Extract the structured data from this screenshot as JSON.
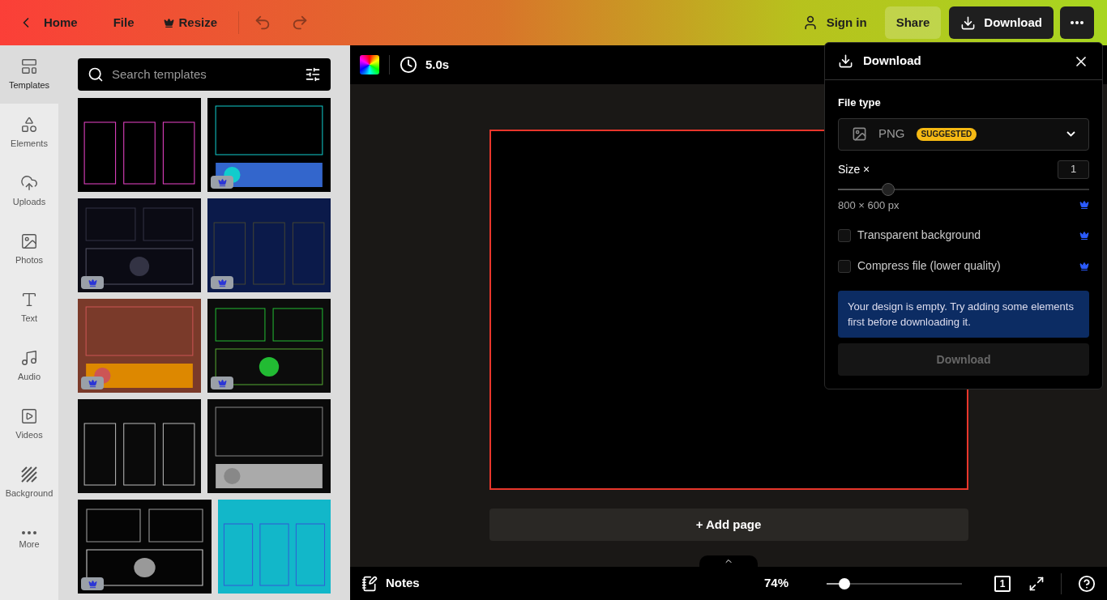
{
  "topbar": {
    "back": "Home",
    "menu": [
      "File",
      "Resize"
    ],
    "sign_in": "Sign in",
    "share": "Share",
    "download": "Download"
  },
  "rail": [
    {
      "label": "Templates",
      "selected": true
    },
    {
      "label": "Elements",
      "selected": false
    },
    {
      "label": "Uploads",
      "selected": false
    },
    {
      "label": "Photos",
      "selected": false
    },
    {
      "label": "Text",
      "selected": false
    },
    {
      "label": "Audio",
      "selected": false
    },
    {
      "label": "Videos",
      "selected": false
    },
    {
      "label": "Background",
      "selected": false
    },
    {
      "label": "More",
      "selected": false
    }
  ],
  "search": {
    "placeholder": "Search templates"
  },
  "templates": [
    {
      "premium": false
    },
    {
      "premium": true
    },
    {
      "premium": true
    },
    {
      "premium": true
    },
    {
      "premium": true
    },
    {
      "premium": true
    },
    {
      "premium": false
    },
    {
      "premium": false
    },
    {
      "premium": true
    },
    {
      "premium": false
    }
  ],
  "toolbar": {
    "duration": "5.0s"
  },
  "canvas": {
    "add_page": "+ Add page"
  },
  "bottom_bar": {
    "notes": "Notes",
    "zoom": "74%",
    "zoom_slider": {
      "level": 0.13
    },
    "page_count": "1"
  },
  "download_panel": {
    "title": "Download",
    "file_type_label": "File type",
    "file_type": "PNG",
    "badge": "SUGGESTED",
    "size_label": "Size ×",
    "size_value": "1",
    "size_slider": {
      "level": 0.2
    },
    "dimensions": "800 × 600 px",
    "options": [
      {
        "label": "Transparent background",
        "checked": false
      },
      {
        "label": "Compress file (lower quality)",
        "checked": false
      }
    ],
    "notice": "Your design is empty. Try adding some elements first before downloading it.",
    "button": "Download",
    "button_disabled": true
  }
}
